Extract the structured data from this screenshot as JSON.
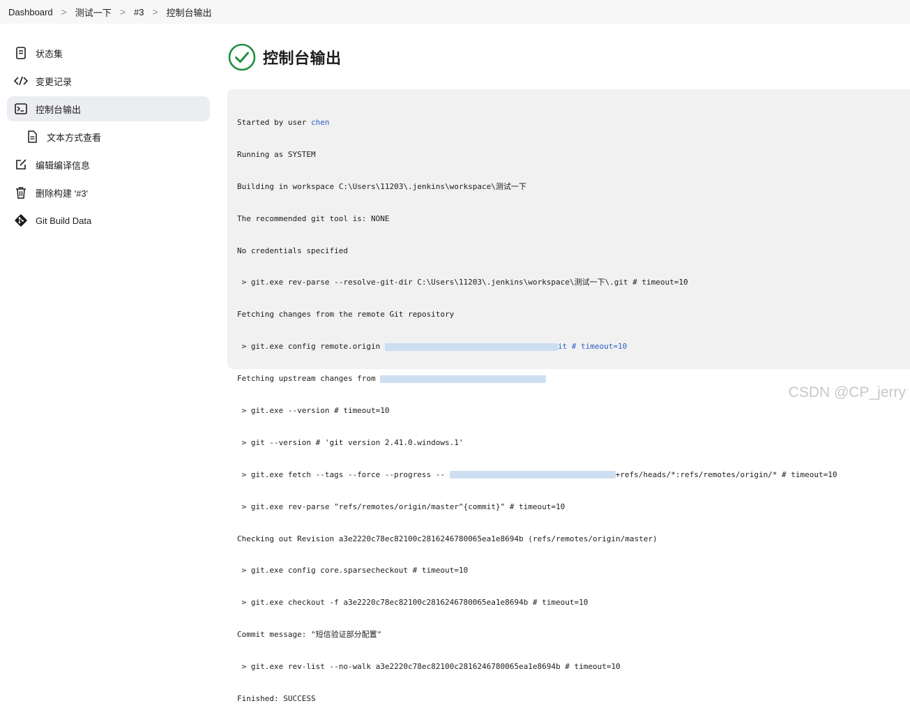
{
  "breadcrumb": {
    "items": [
      "Dashboard",
      "测试一下",
      "#3",
      "控制台输出"
    ],
    "separator": ">"
  },
  "sidebar": {
    "items": [
      {
        "label": "状态集",
        "icon": "document-icon",
        "active": false
      },
      {
        "label": "变更记录",
        "icon": "code-icon",
        "active": false
      },
      {
        "label": "控制台输出",
        "icon": "terminal-icon",
        "active": true
      },
      {
        "label": "文本方式查看",
        "icon": "file-text-icon",
        "active": false
      },
      {
        "label": "编辑编译信息",
        "icon": "edit-icon",
        "active": false
      },
      {
        "label": "删除构建 '#3'",
        "icon": "trash-icon",
        "active": false
      },
      {
        "label": "Git Build Data",
        "icon": "git-icon",
        "active": false
      }
    ]
  },
  "main": {
    "title": "控制台输出",
    "status_icon": "success-check-icon",
    "status_color": "#1e8e3e"
  },
  "console": {
    "user_prefix": "Started by user ",
    "user": "chen",
    "lines": [
      "Running as SYSTEM",
      "Building in workspace C:\\Users\\11203\\.jenkins\\workspace\\测试一下",
      "The recommended git tool is: NONE",
      "No credentials specified",
      " > git.exe rev-parse --resolve-git-dir C:\\Users\\11203\\.jenkins\\workspace\\测试一下\\.git # timeout=10",
      "Fetching changes from the remote Git repository"
    ],
    "config_prefix": " > git.exe config remote.origin",
    "config_suffix": "it # timeout=10",
    "upstream_prefix": "Fetching upstream changes from ",
    "lines2": [
      " > git.exe --version # timeout=10",
      " > git --version # 'git version 2.41.0.windows.1'"
    ],
    "fetch_prefix": " > git.exe fetch --tags --force --progress -- ",
    "fetch_suffix": "+refs/heads/*:refs/remotes/origin/* # timeout=10",
    "lines3": [
      " > git.exe rev-parse \"refs/remotes/origin/master^{commit}\" # timeout=10",
      "Checking out Revision a3e2220c78ec82100c2816246780065ea1e8694b (refs/remotes/origin/master)",
      " > git.exe config core.sparsecheckout # timeout=10",
      " > git.exe checkout -f a3e2220c78ec82100c2816246780065ea1e8694b # timeout=10",
      "Commit message: \"短信验证部分配置\"",
      " > git.exe rev-list --no-walk a3e2220c78ec82100c2816246780065ea1e8694b # timeout=10",
      "Finished: SUCCESS"
    ]
  },
  "watermark": "CSDN @CP_jerry"
}
